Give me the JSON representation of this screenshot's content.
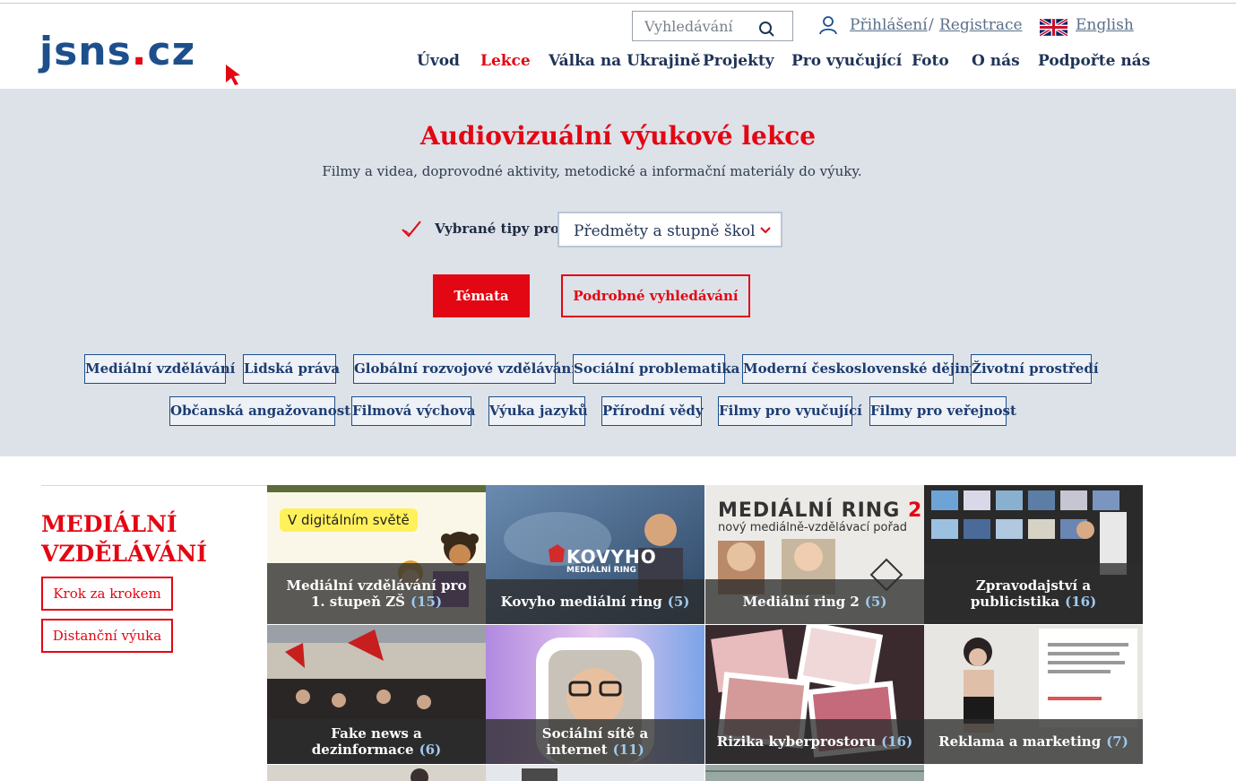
{
  "header": {
    "logo_text": "jsns",
    "logo_dot": ".",
    "logo_tld": "cz",
    "search_placeholder": "Vyhledávání",
    "login": "Přihlášení",
    "separator": "/",
    "register": "Registrace",
    "language": "English"
  },
  "nav": [
    "Úvod",
    "Lekce",
    "Válka na Ukrajině",
    "Projekty",
    "Pro vyučující",
    "Foto",
    "O nás",
    "Podpořte nás"
  ],
  "hero": {
    "title": "Audiovizuální výukové lekce",
    "subtitle": "Filmy a videa, doprovodné aktivity, metodické a informační materiály do výuky.",
    "tips_label": "Vybrané tipy pro:",
    "select_value": "Předměty a stupně škol",
    "btn_topics": "Témata",
    "btn_advanced": "Podrobné vyhledávání"
  },
  "tags_row1": [
    "Mediální vzdělávání",
    "Lidská práva",
    "Globální rozvojové vzdělávání",
    "Sociální problematika",
    "Moderní československé dějiny",
    "Životní prostředí"
  ],
  "tags_row2": [
    "Občanská angažovanost",
    "Filmová výchova",
    "Výuka jazyků",
    "Přírodní vědy",
    "Filmy pro vyučující",
    "Filmy pro veřejnost"
  ],
  "section": {
    "title": "MEDIÁLNÍ VZDĚLÁVÁNÍ",
    "btn_step": "Krok za krokem",
    "btn_remote": "Distanční výuka"
  },
  "tiles": [
    {
      "title": "Mediální vzdělávání pro 1. stupeň ZŠ",
      "count": "(15)",
      "badge": "V digitálním světě"
    },
    {
      "title": "Kovyho mediální ring",
      "count": "(5)",
      "brand": "KOVYHO",
      "brand_sub": "MEDIÁLNÍ RING"
    },
    {
      "title": "Mediální ring 2",
      "count": "(5)",
      "heading": "MEDIÁLNÍ RING",
      "heading_num": "2",
      "heading_sub": "nový mediálně-vzdělávací pořad"
    },
    {
      "title": "Zpravodajství a publicistika",
      "count": "(16)"
    },
    {
      "title": "Fake news a dezinformace",
      "count": "(6)"
    },
    {
      "title": "Sociální sítě a internet",
      "count": "(11)"
    },
    {
      "title": "Rizika kyberprostoru",
      "count": "(16)"
    },
    {
      "title": "Reklama a marketing",
      "count": "(7)"
    }
  ],
  "colors": {
    "accent_red": "#e30613",
    "brand_blue": "#1d4f8c",
    "hero_bg": "#dde2e8"
  }
}
